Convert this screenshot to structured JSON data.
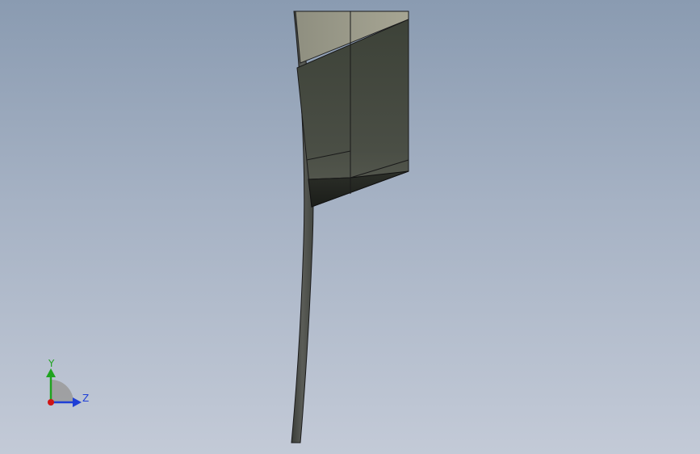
{
  "triad": {
    "y_label": "Y",
    "z_label": "Z"
  },
  "colors": {
    "background_top": "#8a9bb1",
    "background_bottom": "#c3cad7",
    "y_axis": "#1fa31f",
    "z_axis": "#1f3fd6",
    "x_axis": "#d01515"
  }
}
